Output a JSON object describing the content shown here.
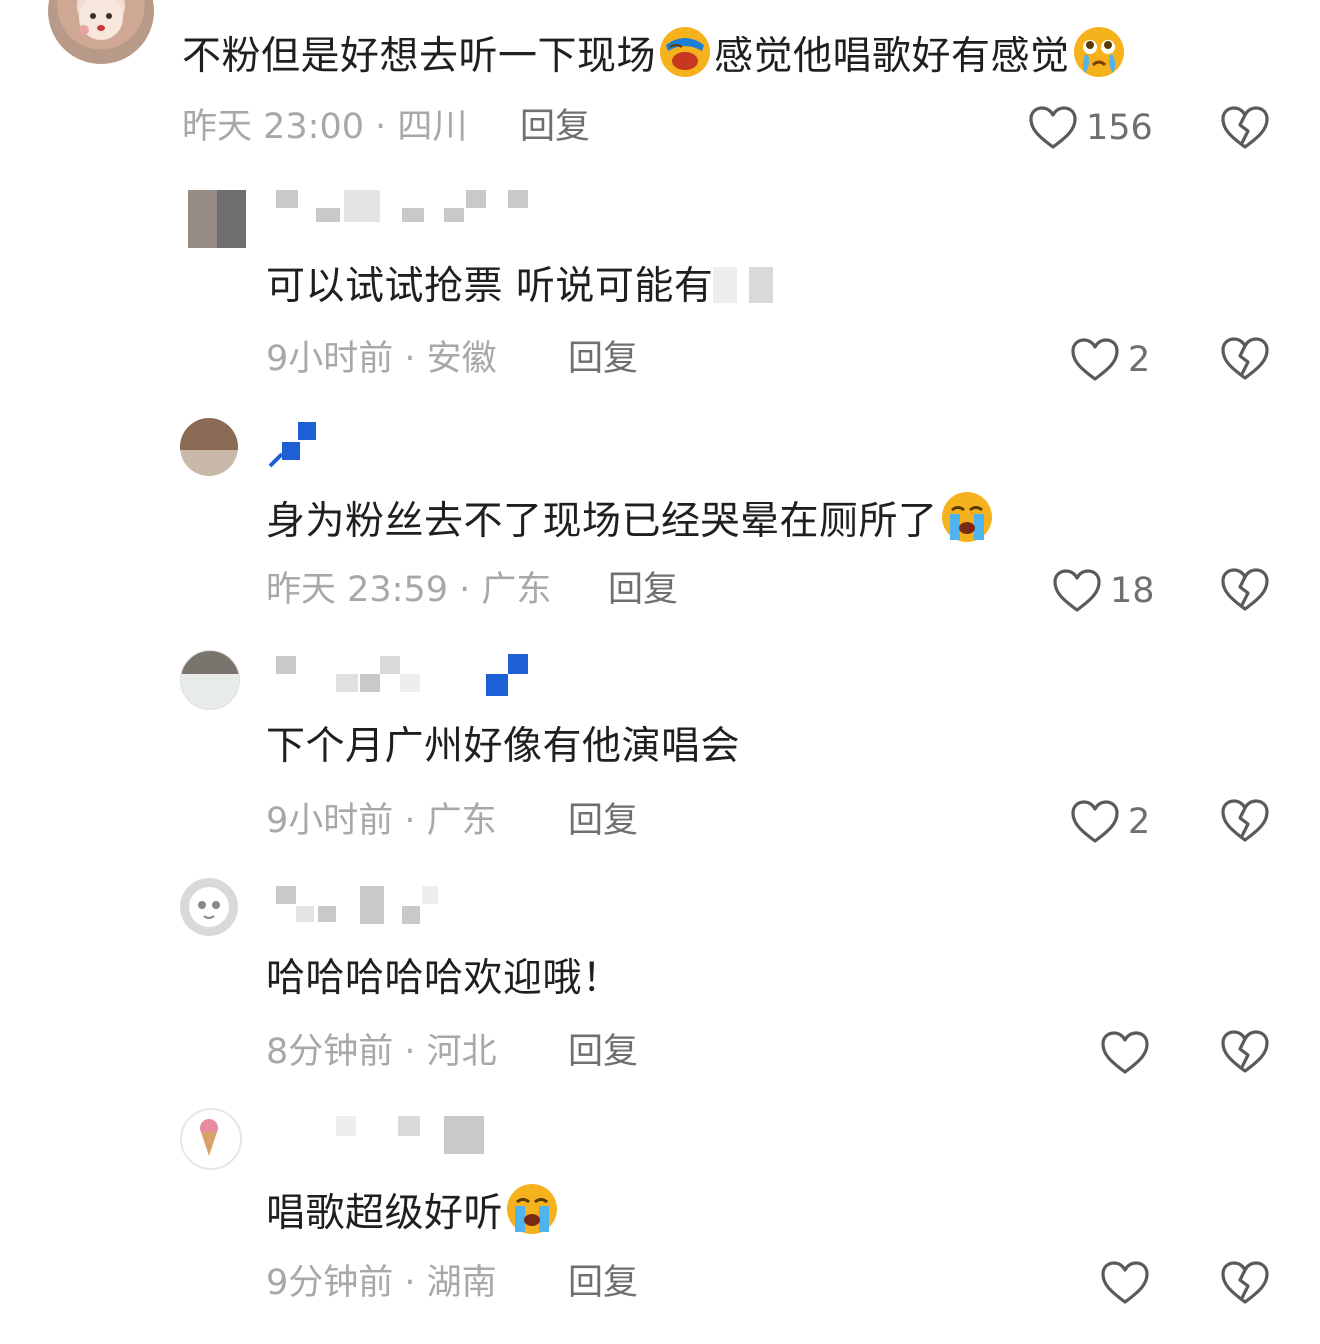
{
  "comments": [
    {
      "text_a": "不粉但是好想去听一下现场",
      "text_b": "感觉他唱歌好有感觉",
      "emoji_1": "face-palm-emoji",
      "emoji_2": "teary-face-emoji",
      "time": "昨天 23:00",
      "location": "四川",
      "reply": "回复",
      "likes": "156"
    },
    {
      "text": "可以试试抢票  听说可能有",
      "time": "9小时前",
      "location": "安徽",
      "reply": "回复",
      "likes": "2"
    },
    {
      "text": "身为粉丝去不了现场已经哭晕在厕所了",
      "emoji": "crying-face-emoji",
      "time": "昨天 23:59",
      "location": "广东",
      "reply": "回复",
      "likes": "18"
    },
    {
      "text": "下个月广州好像有他演唱会",
      "time": "9小时前",
      "location": "广东",
      "reply": "回复",
      "likes": "2"
    },
    {
      "text": "哈哈哈哈哈欢迎哦！",
      "time": "8分钟前",
      "location": "河北",
      "reply": "回复",
      "likes": ""
    },
    {
      "text": "唱歌超级好听",
      "emoji": "crying-face-emoji",
      "time": "9分钟前",
      "location": "湖南",
      "reply": "回复",
      "likes": ""
    }
  ],
  "separator": " · ",
  "icons": {
    "like": "heart-outline-icon",
    "dislike": "broken-heart-icon"
  },
  "colors": {
    "text": "#1f1f1f",
    "meta": "#a8a8a8",
    "action": "#6f6f6f",
    "icon": "#5a5a5a",
    "emoji": "#f5b21c",
    "verified": "#1e5fd6"
  }
}
